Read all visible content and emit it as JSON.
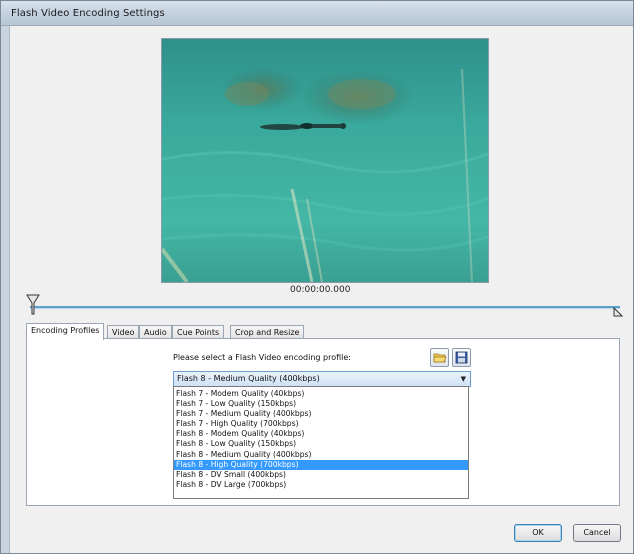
{
  "window": {
    "title": "Flash Video Encoding Settings"
  },
  "preview": {
    "timecode": "00:00:00.000"
  },
  "tabs": [
    {
      "label": "Encoding Profiles",
      "active": true
    },
    {
      "label": "Video",
      "active": false
    },
    {
      "label": "Audio",
      "active": false
    },
    {
      "label": "Cue Points",
      "active": false
    },
    {
      "label": "Crop and Resize",
      "active": false
    }
  ],
  "encoding": {
    "prompt": "Please select a Flash Video encoding profile:",
    "selected_profile": "Flash 8 - Medium Quality (400kbps)",
    "icons": [
      "open-folder-icon",
      "save-disk-icon"
    ],
    "options": [
      "Flash 7 - Modem Quality (40kbps)",
      "Flash 7 - Low Quality (150kbps)",
      "Flash 7 - Medium Quality (400kbps)",
      "Flash 7 - High Quality (700kbps)",
      "Flash 8 - Modem Quality (40kbps)",
      "Flash 8 - Low Quality (150kbps)",
      "Flash 8 - Medium Quality (400kbps)",
      "Flash 8 - High Quality (700kbps)",
      "Flash 8 - DV Small (400kbps)",
      "Flash 8 - DV Large (700kbps)"
    ],
    "highlighted_option": "Flash 8 - High Quality (700kbps)"
  },
  "buttons": {
    "ok": "OK",
    "cancel": "Cancel"
  },
  "colors": {
    "highlight": "#3399ff",
    "track": "#5aa1cc",
    "water": "#3fa89c"
  }
}
